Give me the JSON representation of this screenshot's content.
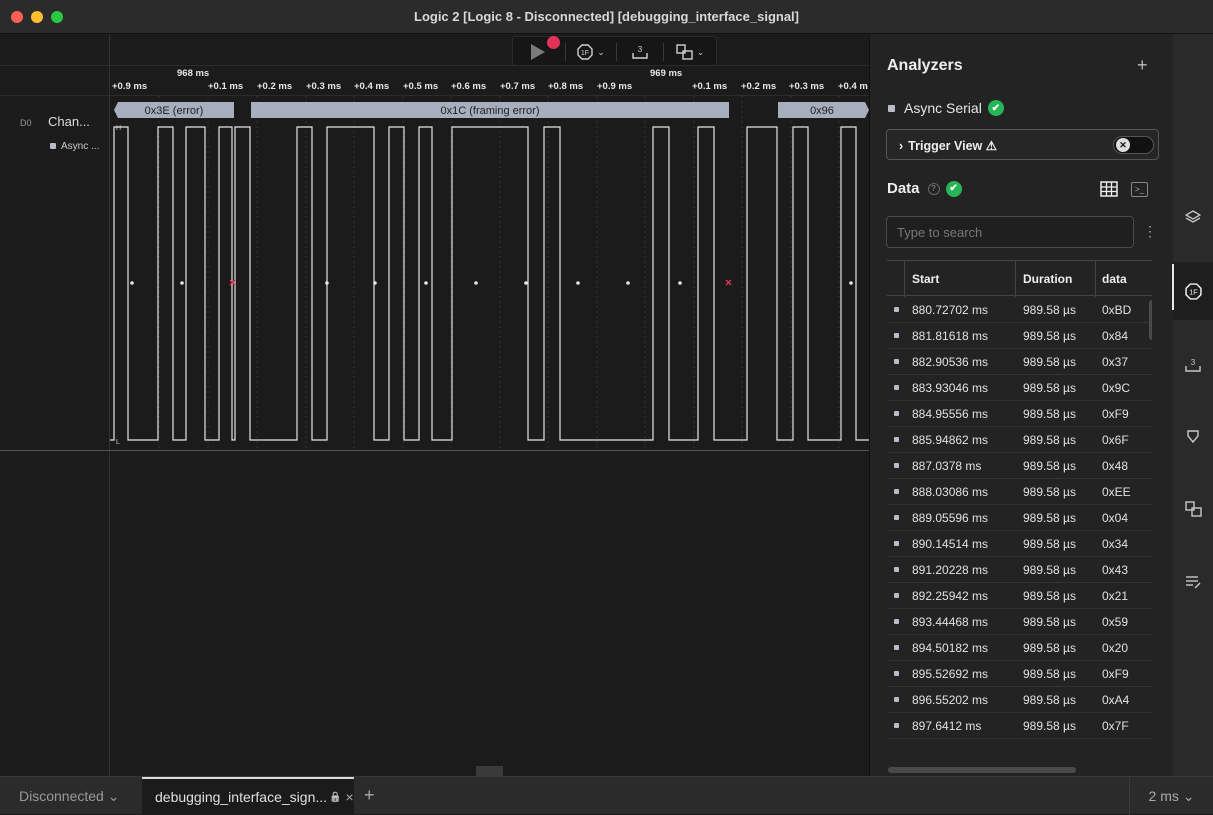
{
  "window": {
    "title": "Logic 2 [Logic 8 - Disconnected] [debugging_interface_signal]"
  },
  "ruler": {
    "labels": [
      {
        "text": "+0.9 ms"
      },
      {
        "text": "968 ms"
      },
      {
        "text": "+0.1 ms"
      },
      {
        "text": "+0.2 ms"
      },
      {
        "text": "+0.3 ms"
      },
      {
        "text": "+0.4 ms"
      },
      {
        "text": "+0.5 ms"
      },
      {
        "text": "+0.6 ms"
      },
      {
        "text": "+0.7 ms"
      },
      {
        "text": "+0.8 ms"
      },
      {
        "text": "+0.9 ms"
      },
      {
        "text": "969 ms"
      },
      {
        "text": "+0.1 ms"
      },
      {
        "text": "+0.2 ms"
      },
      {
        "text": "+0.3 ms"
      },
      {
        "text": "+0.4 m"
      }
    ]
  },
  "channel": {
    "id": "D0",
    "name": "Chan...",
    "sub": "Async ...",
    "high_label": "H",
    "low_label": "L"
  },
  "frames": [
    {
      "text": "0x3E (error)"
    },
    {
      "text": "0x1C (framing error)"
    },
    {
      "text": "0x96"
    }
  ],
  "analyzers": {
    "title": "Analyzers",
    "add": "+",
    "items": [
      {
        "name": "Async Serial",
        "status": "✔"
      }
    ],
    "trigger_view": {
      "label": "Trigger View ⚠",
      "chevron": "›",
      "toggle": "✕"
    }
  },
  "data_section": {
    "title": "Data",
    "help": "?",
    "status": "✔",
    "search_placeholder": "Type to search",
    "more": "⋮",
    "terminal_icon_text": ">_"
  },
  "table": {
    "headers": {
      "start": "Start",
      "duration": "Duration",
      "data": "data"
    },
    "rows": [
      {
        "start": "880.72702 ms",
        "duration": "989.58 µs",
        "data": "0xBD"
      },
      {
        "start": "881.81618 ms",
        "duration": "989.58 µs",
        "data": "0x84"
      },
      {
        "start": "882.90536 ms",
        "duration": "989.58 µs",
        "data": "0x37"
      },
      {
        "start": "883.93046 ms",
        "duration": "989.58 µs",
        "data": "0x9C"
      },
      {
        "start": "884.95556 ms",
        "duration": "989.58 µs",
        "data": "0xF9"
      },
      {
        "start": "885.94862 ms",
        "duration": "989.58 µs",
        "data": "0x6F"
      },
      {
        "start": "887.0378 ms",
        "duration": "989.58 µs",
        "data": "0x48"
      },
      {
        "start": "888.03086 ms",
        "duration": "989.58 µs",
        "data": "0xEE"
      },
      {
        "start": "889.05596 ms",
        "duration": "989.58 µs",
        "data": "0x04"
      },
      {
        "start": "890.14514 ms",
        "duration": "989.58 µs",
        "data": "0x34"
      },
      {
        "start": "891.20228 ms",
        "duration": "989.58 µs",
        "data": "0x43"
      },
      {
        "start": "892.25942 ms",
        "duration": "989.58 µs",
        "data": "0x21"
      },
      {
        "start": "893.44468 ms",
        "duration": "989.58 µs",
        "data": "0x59"
      },
      {
        "start": "894.50182 ms",
        "duration": "989.58 µs",
        "data": "0x20"
      },
      {
        "start": "895.52692 ms",
        "duration": "989.58 µs",
        "data": "0xF9"
      },
      {
        "start": "896.55202 ms",
        "duration": "989.58 µs",
        "data": "0xA4"
      },
      {
        "start": "897.6412 ms",
        "duration": "989.58 µs",
        "data": "0x7F"
      }
    ]
  },
  "status_bar": {
    "device": "Disconnected ⌄",
    "tab": "debugging_interface_sign...",
    "tab_lock": "🔒",
    "tab_close": "×",
    "add": "+",
    "zoom": "2 ms ⌄"
  },
  "toolbar": {
    "t3": "3"
  },
  "colors": {
    "accent_red": "#e0335a",
    "check_green": "#27b557",
    "frame_fill": "#a7aebd",
    "error_x": "#e0335a"
  }
}
